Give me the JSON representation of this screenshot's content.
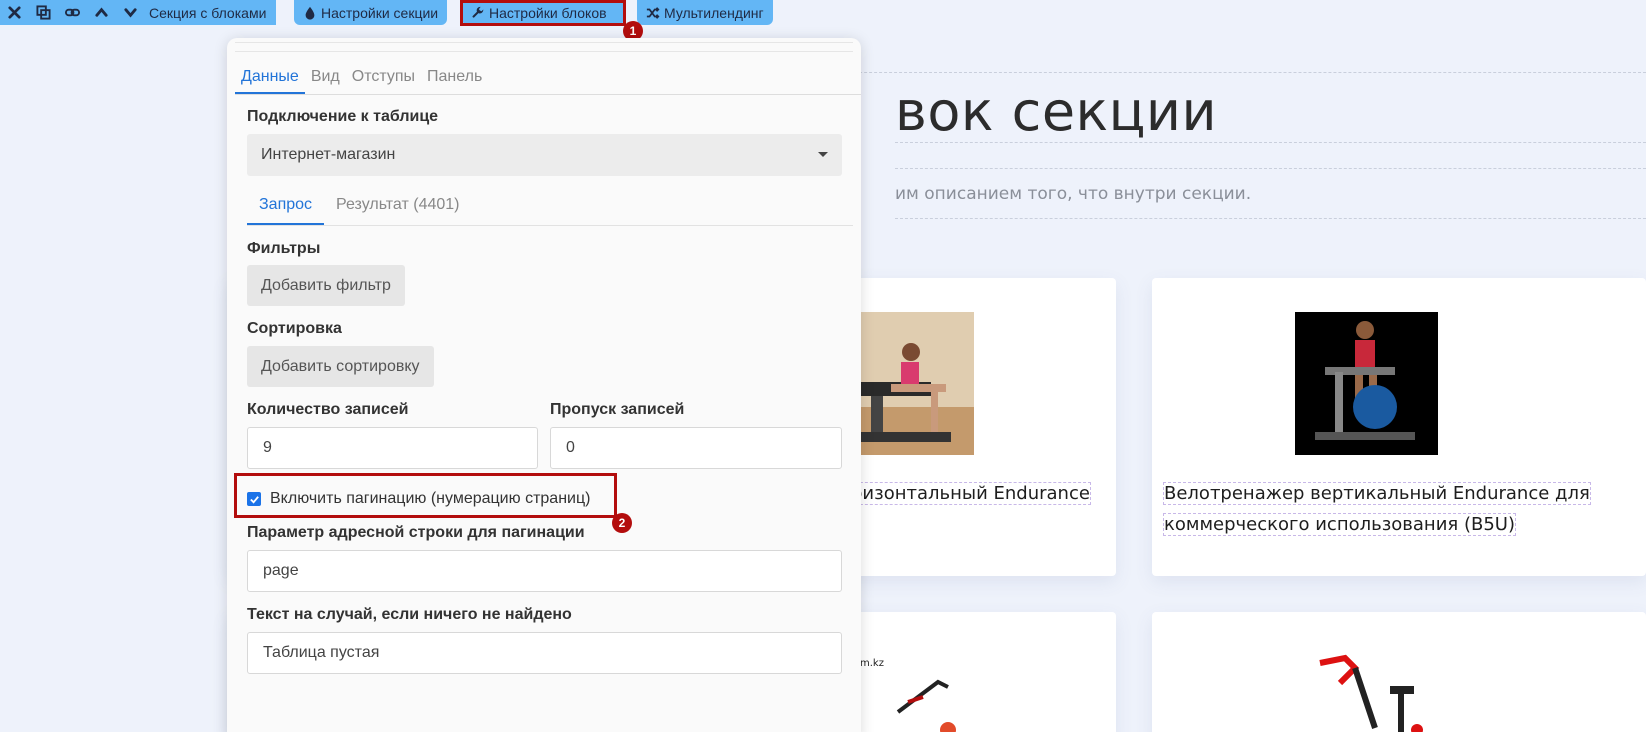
{
  "toolbar": {
    "section_label": "Секция с блоками",
    "section_settings": "Настройки секции",
    "block_settings": "Настройки блоков",
    "multilanding": "Мультилендинг",
    "icons": [
      "close-icon",
      "copy-icon",
      "link-icon",
      "chevron-up-icon",
      "chevron-down-icon"
    ],
    "accent": "#63b6f5",
    "highlight_color": "#b30d0d"
  },
  "badges": {
    "first": "1",
    "second": "2"
  },
  "background": {
    "title": "вок секции",
    "subtitle": "им описанием того, что внутри секции.",
    "cards": [
      {
        "title": "ризонтальный Endurance"
      },
      {
        "title_line1": "Велотренажер вертикальный Endurance для",
        "title_line2": "коммерческого использования (B5U)"
      }
    ]
  },
  "panel": {
    "tabs": [
      {
        "label": "Данные",
        "active": true
      },
      {
        "label": "Вид",
        "active": false
      },
      {
        "label": "Отступы",
        "active": false
      },
      {
        "label": "Панель",
        "active": false
      }
    ],
    "table_connection_label": "Подключение к таблице",
    "table_connection_value": "Интернет-магазин",
    "subtabs": [
      {
        "label": "Запрос",
        "active": true
      },
      {
        "label": "Результат (4401)",
        "active": false
      }
    ],
    "filters_label": "Фильтры",
    "add_filter": "Добавить фильтр",
    "sorting_label": "Сортировка",
    "add_sorting": "Добавить сортировку",
    "records_count_label": "Количество записей",
    "records_count_value": "9",
    "records_skip_label": "Пропуск записей",
    "records_skip_value": "0",
    "pagination_label": "Включить пагинацию (нумерацию страниц)",
    "pagination_checked": true,
    "pagination_param_label": "Параметр адресной строки для пагинации",
    "pagination_param_value": "page",
    "empty_text_label": "Текст на случай, если ничего не найдено",
    "empty_text_value": "Таблица пустая"
  }
}
